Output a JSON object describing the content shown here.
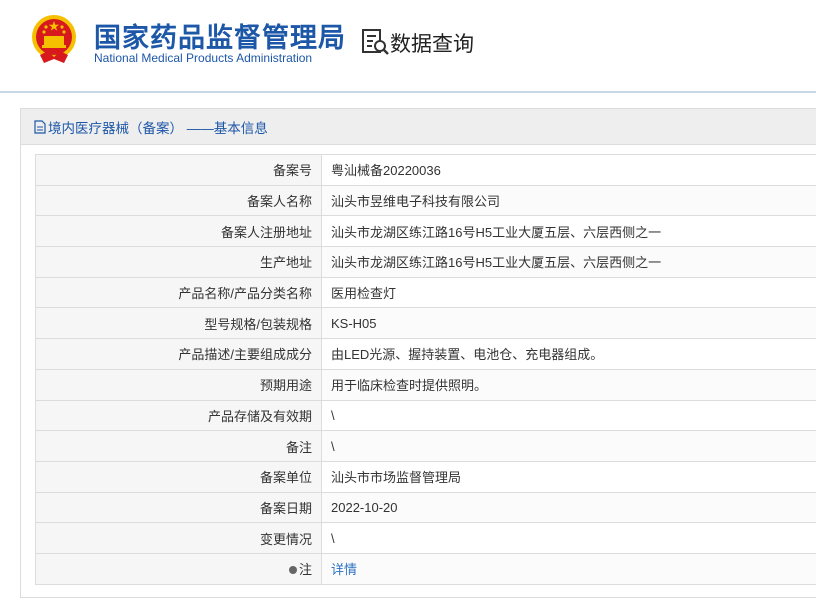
{
  "header": {
    "agency_cn": "国家药品监督管理局",
    "agency_en": "National Medical Products Administration",
    "query_title": "数据查询"
  },
  "panel": {
    "title": "境内医疗器械（备案） ——基本信息"
  },
  "rows": [
    {
      "label": "备案号",
      "value": "粤汕械备20220036"
    },
    {
      "label": "备案人名称",
      "value": "汕头市昱维电子科技有限公司"
    },
    {
      "label": "备案人注册地址",
      "value": "汕头市龙湖区练江路16号H5工业大厦五层、六层西侧之一"
    },
    {
      "label": "生产地址",
      "value": "汕头市龙湖区练江路16号H5工业大厦五层、六层西侧之一"
    },
    {
      "label": "产品名称/产品分类名称",
      "value": "医用检查灯"
    },
    {
      "label": "型号规格/包装规格",
      "value": "KS-H05"
    },
    {
      "label": "产品描述/主要组成成分",
      "value": "由LED光源、握持装置、电池仓、充电器组成。"
    },
    {
      "label": "预期用途",
      "value": "用于临床检查时提供照明。"
    },
    {
      "label": "产品存储及有效期",
      "value": "\\"
    },
    {
      "label": "备注",
      "value": "\\"
    },
    {
      "label": "备案单位",
      "value": "汕头市市场监督管理局"
    },
    {
      "label": "备案日期",
      "value": "2022-10-20"
    },
    {
      "label": "变更情况",
      "value": "\\"
    },
    {
      "label": "注",
      "value": "详情"
    }
  ],
  "colors": {
    "brand_blue": "#1d57a8",
    "link_blue": "#2e72c4",
    "emblem_red": "#d7191e",
    "emblem_gold": "#f5c000"
  },
  "icons": {
    "emblem": "national-emblem-icon",
    "query": "document-search-icon",
    "panel_title": "document-icon",
    "note": "pin-icon"
  }
}
